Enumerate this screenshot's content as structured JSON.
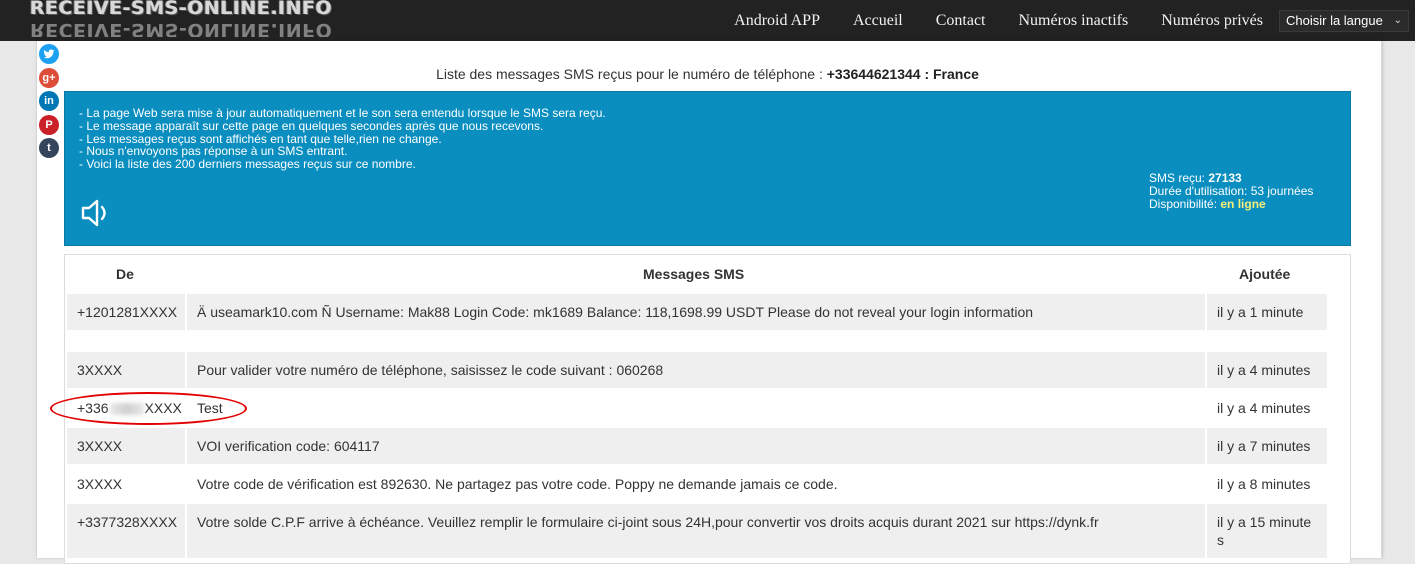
{
  "navbar": {
    "logo_text": "RECEIVE-SMS-ONLINE.INFO",
    "links": [
      "Android APP",
      "Accueil",
      "Contact",
      "Numéros inactifs",
      "Numéros privés"
    ],
    "language_select": "Choisir la langue"
  },
  "social": [
    "twitter-icon",
    "google-plus-icon",
    "linkedin-icon",
    "pinterest-icon",
    "tumblr-icon"
  ],
  "page": {
    "title_prefix": "Liste des messages SMS reçus pour le numéro de téléphone : ",
    "title_number": "+33644621344 : France"
  },
  "info": {
    "lines": [
      "- La page Web sera mise à jour automatiquement et le son sera entendu lorsque le SMS sera reçu.",
      "- Le message apparaît sur cette page en quelques secondes après que nous recevons.",
      "- Les messages reçus sont affichés en tant que telle,rien ne change.",
      "- Nous n'envoyons pas réponse à un SMS entrant.",
      "- Voici la liste des 200 derniers messages reçus sur ce nombre."
    ],
    "sms_label": "SMS reçu: ",
    "sms_count": "27133",
    "duration_label": "Durée d'utilisation: ",
    "duration_value": "53 journées",
    "availability_label": "Disponibilité: ",
    "availability_value": "en ligne",
    "colors": {
      "box": "#0a8ec0",
      "online": "#f5ef7a"
    }
  },
  "table": {
    "headers": {
      "from": "De",
      "message": "Messages SMS",
      "added": "Ajoutée"
    },
    "rows": [
      {
        "from": "+1201281XXXX",
        "message": "Ä useamark10.com Ñ Username: Mak88 Login Code: mk1689 Balance: 118,1698.99 USDT Please do not reveal your login information",
        "added": "il y a 1 minute"
      },
      {
        "from": "3XXXX",
        "message": "Pour valider votre numéro de téléphone, saisissez le code suivant : 060268",
        "added": "il y a 4 minutes"
      },
      {
        "from_prefix": "+336",
        "from_suffix": "XXXX",
        "message": "Test",
        "added": "il y a 4 minutes"
      },
      {
        "from": "3XXXX",
        "message": "VOI verification code: 604117",
        "added": "il y a 7 minutes"
      },
      {
        "from": "3XXXX",
        "message": "Votre code de vérification est 892630. Ne partagez pas votre code. Poppy ne demande jamais ce code.",
        "added": "il y a 8 minutes"
      },
      {
        "from": "+3377328XXXX",
        "message": "Votre solde C.P.F arrive à échéance. Veuillez remplir le formulaire ci-joint sous 24H,pour convertir vos droits acquis durant 2021 sur https://dynk.fr",
        "added": "il y a 15 minute s"
      }
    ]
  }
}
